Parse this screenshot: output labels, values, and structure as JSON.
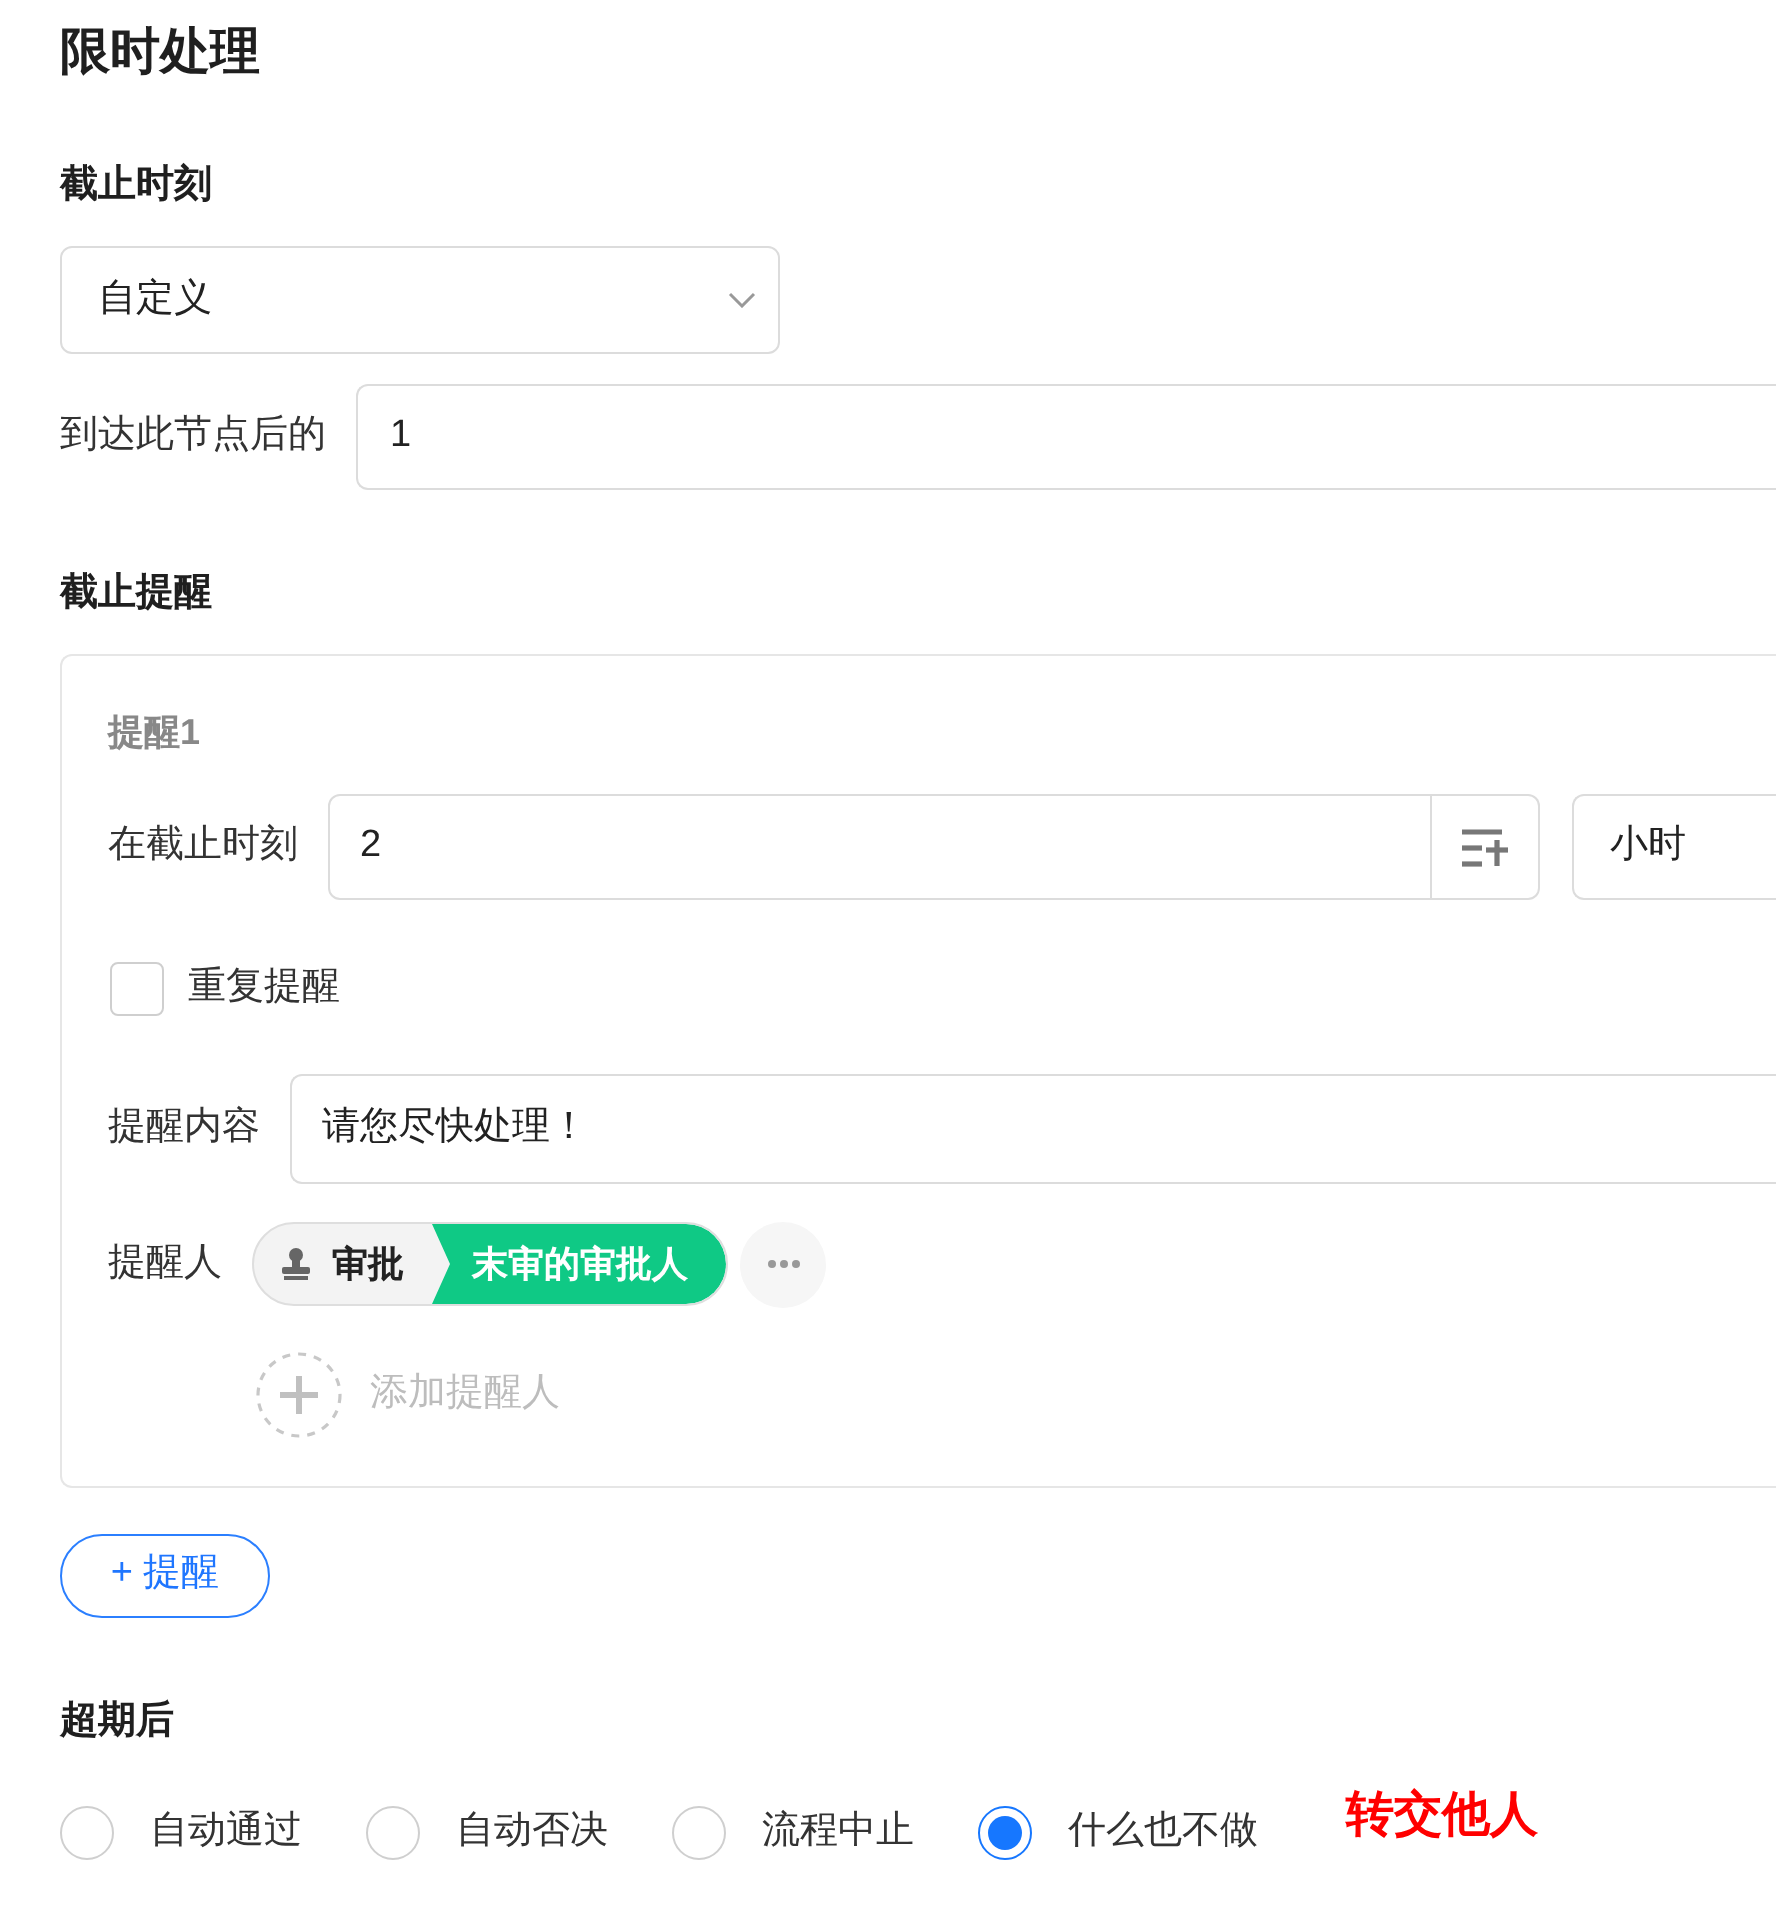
{
  "title": "限时处理",
  "deadline": {
    "heading": "截止时刻",
    "mode_select": {
      "value": "自定义"
    },
    "after_label": "到达此节点后的",
    "after_value": "1"
  },
  "reminders": {
    "heading": "截止提醒",
    "items": [
      {
        "title": "提醒1",
        "time_label": "在截止时刻",
        "time_value": "2",
        "unit": "小时",
        "repeat": {
          "label": "重复提醒",
          "checked": false
        },
        "content_label": "提醒内容",
        "content_value": "请您尽快处理！",
        "recipients_label": "提醒人",
        "recipients": [
          {
            "tag": "审批",
            "name": "末审的审批人"
          }
        ],
        "add_recipient": "添加提醒人"
      }
    ],
    "add_button": "+ 提醒"
  },
  "overdue": {
    "heading": "超期后",
    "options": [
      {
        "label": "自动通过",
        "selected": false
      },
      {
        "label": "自动否决",
        "selected": false
      },
      {
        "label": "流程中止",
        "selected": false
      },
      {
        "label": "什么也不做",
        "selected": true
      }
    ],
    "note": "转交他人"
  }
}
